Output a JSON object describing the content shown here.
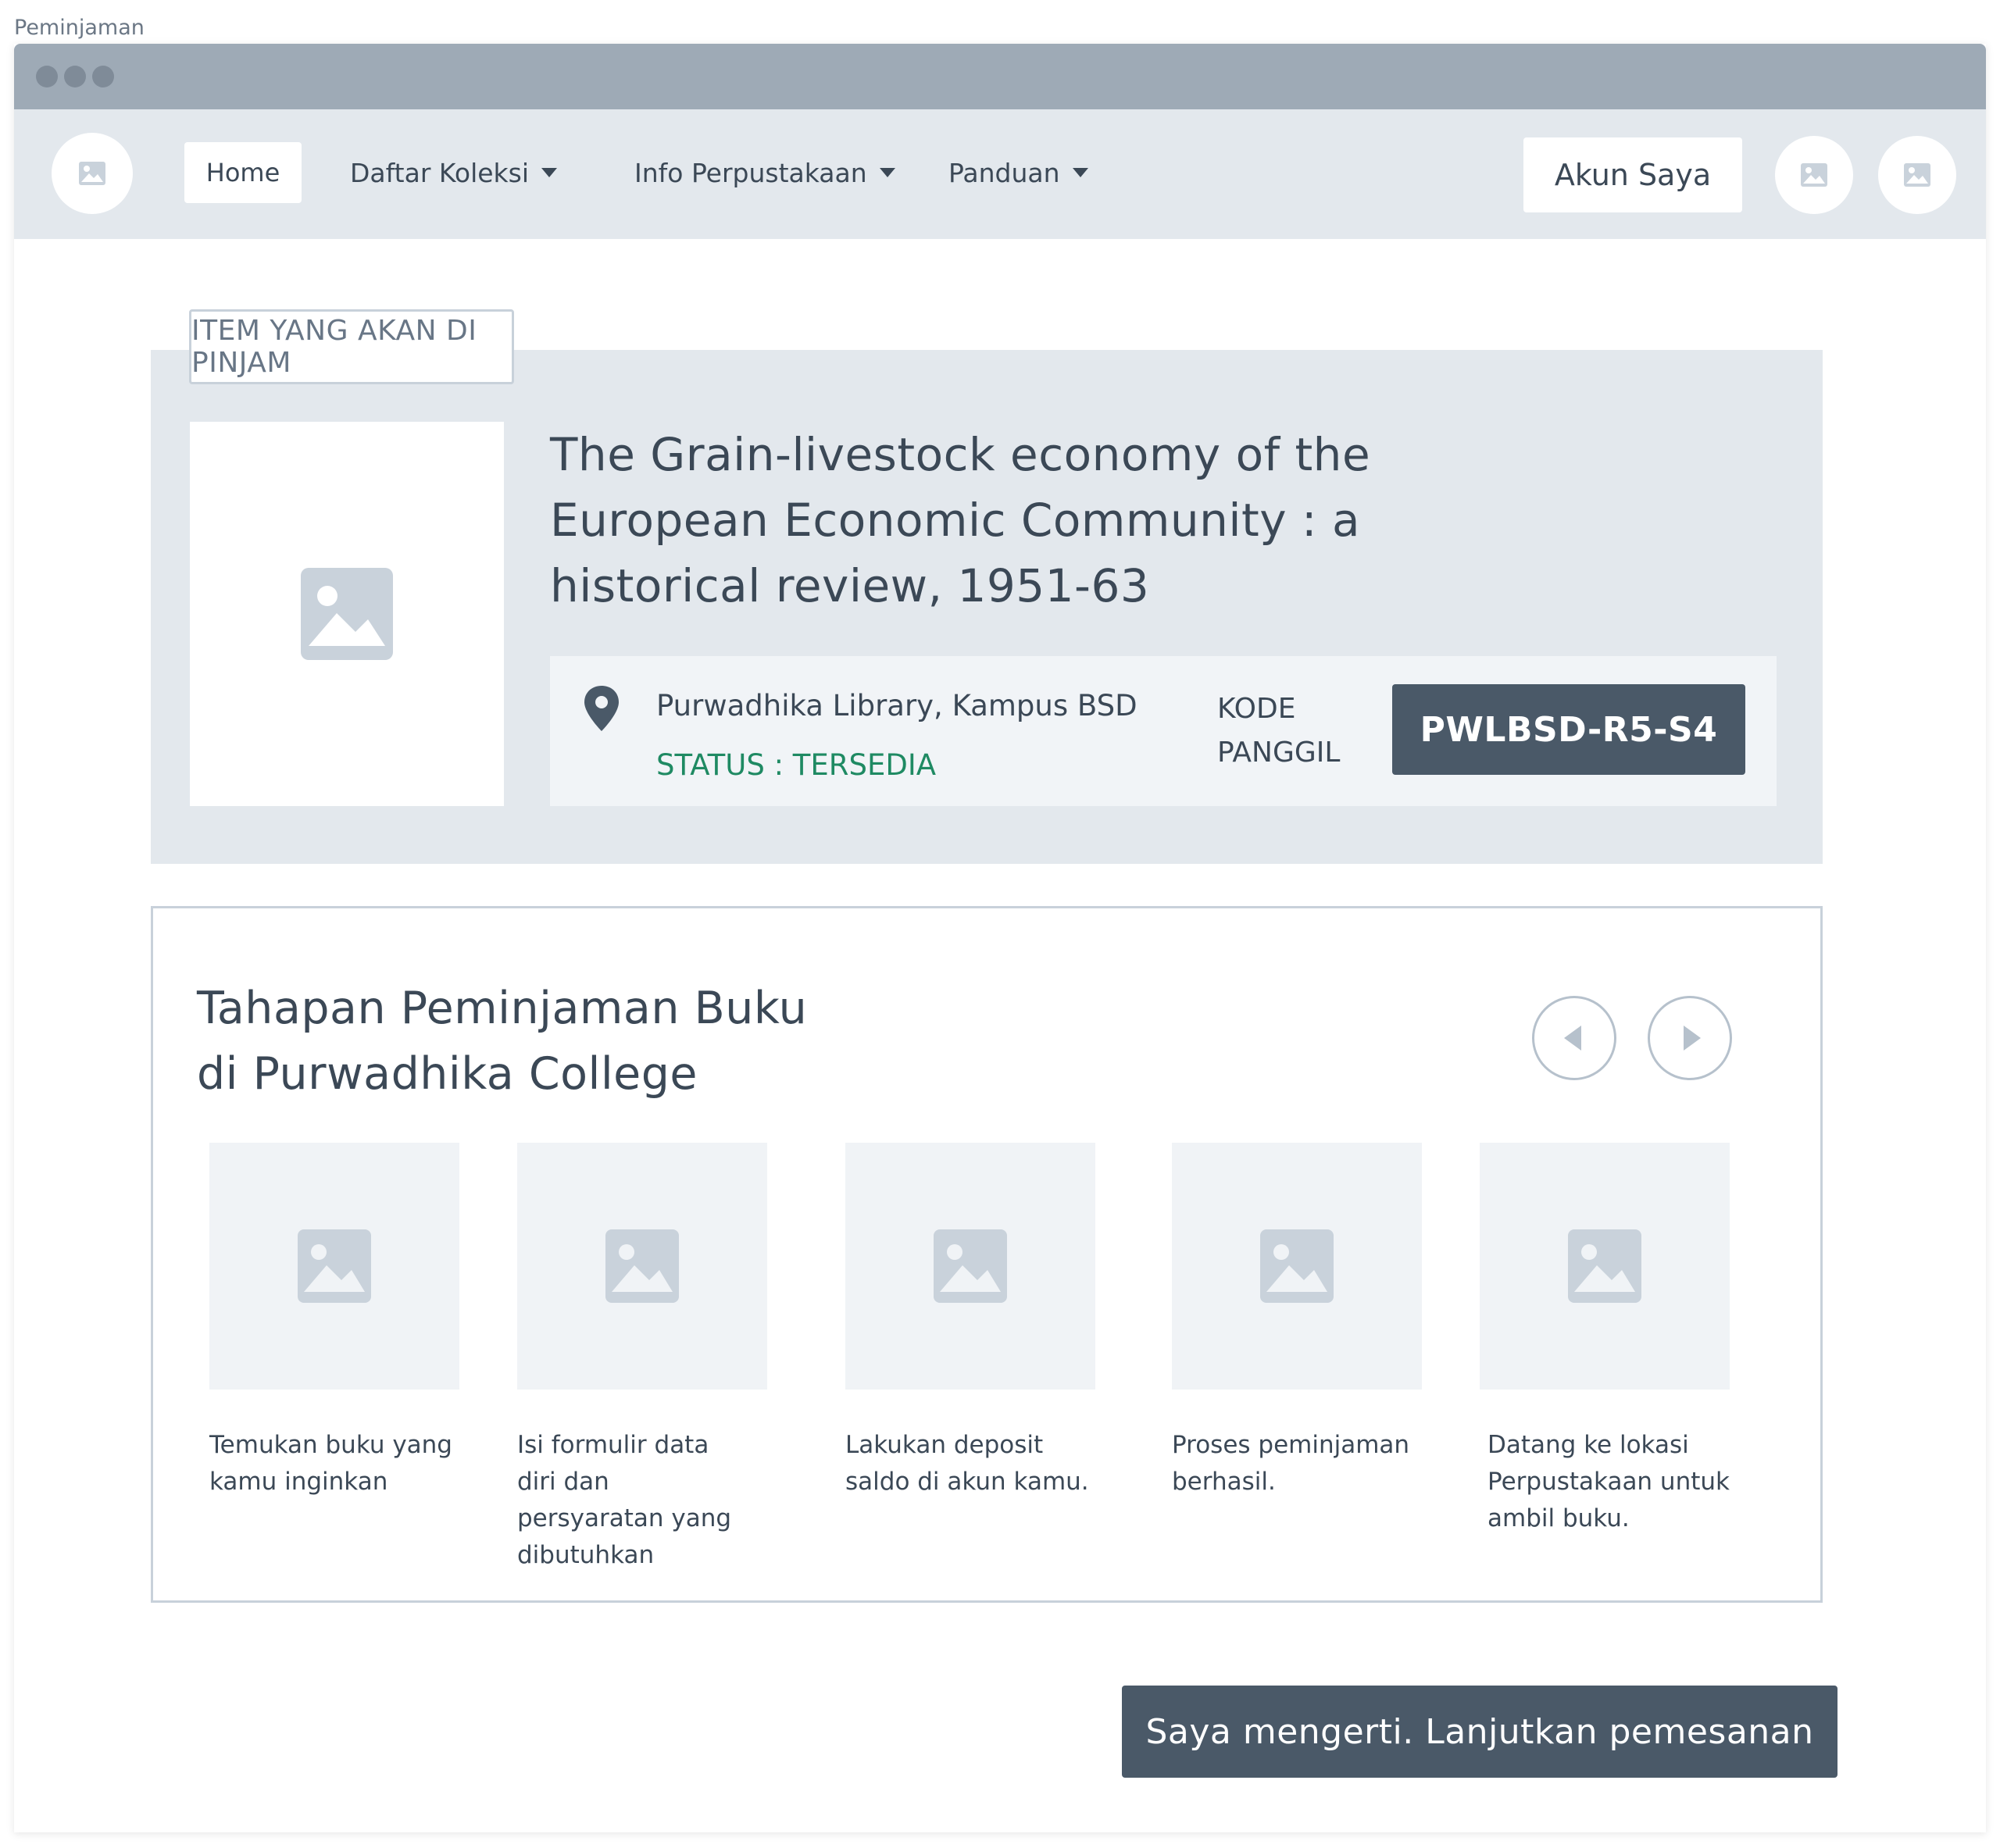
{
  "frame_label": "Peminjaman",
  "nav": {
    "home": "Home",
    "daftar_koleksi": "Daftar Koleksi",
    "info_perpustakaan": "Info Perpustakaan",
    "panduan": "Panduan",
    "akun_saya": "Akun Saya"
  },
  "item": {
    "section_label": "ITEM YANG AKAN DI PINJAM",
    "title_lines": [
      "The Grain-livestock economy of the",
      "European Economic Community : a",
      "historical review, 1951-63"
    ],
    "location": "Purwadhika Library, Kampus BSD",
    "status": "STATUS : TERSEDIA",
    "kode_label_1": "KODE",
    "kode_label_2": "PANGGIL",
    "kode_value": "PWLBSD-R5-S4"
  },
  "steps": {
    "title_line1": "Tahapan Peminjaman Buku",
    "title_line2": "di Purwadhika College",
    "items": [
      {
        "text": "Temukan buku yang kamu inginkan"
      },
      {
        "text": "Isi formulir data diri dan persyaratan yang dibutuhkan"
      },
      {
        "text": "Lakukan deposit saldo di akun kamu."
      },
      {
        "text": "Proses peminjaman berhasil."
      },
      {
        "text": "Datang ke lokasi Perpustakaan untuk ambil buku."
      }
    ]
  },
  "confirm_button": "Saya mengerti. Lanjutkan pemesanan",
  "colors": {
    "accent_dark": "#4a5968",
    "status_green": "#1f8a63",
    "panel_grey": "#e3e8ed"
  }
}
